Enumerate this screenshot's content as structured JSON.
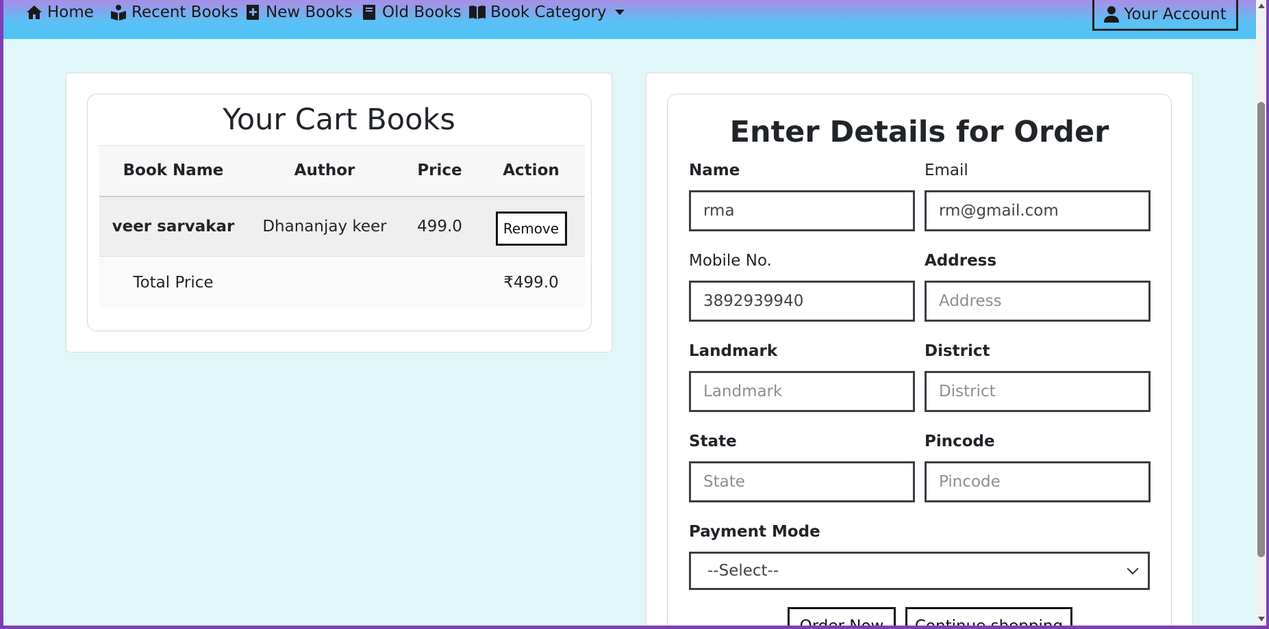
{
  "nav": {
    "home": "Home",
    "recent": "Recent Books",
    "new": "New Books",
    "old": "Old Books",
    "category": "Book Category",
    "account": "Your Account"
  },
  "cart": {
    "title": "Your Cart Books",
    "columns": [
      "Book Name",
      "Author",
      "Price",
      "Action"
    ],
    "items": [
      {
        "book": "veer sarvakar",
        "author": "Dhananjay keer",
        "price": "499.0",
        "action": "Remove"
      }
    ],
    "total_label": "Total Price",
    "total_value": "₹499.0"
  },
  "order": {
    "title": "Enter Details for Order",
    "name": {
      "label": "Name",
      "value": "rma"
    },
    "email": {
      "label": "Email",
      "value": "rm@gmail.com"
    },
    "mobile": {
      "label": "Mobile No.",
      "value": "3892939940"
    },
    "address": {
      "label": "Address",
      "placeholder": "Address"
    },
    "landmark": {
      "label": "Landmark",
      "placeholder": "Landmark"
    },
    "district": {
      "label": "District",
      "placeholder": "District"
    },
    "state": {
      "label": "State",
      "placeholder": "State"
    },
    "pincode": {
      "label": "Pincode",
      "placeholder": "Pincode"
    },
    "payment": {
      "label": "Payment Mode",
      "selected": "--Select--"
    },
    "order_now": "Order Now",
    "continue": "Continue shopping"
  }
}
